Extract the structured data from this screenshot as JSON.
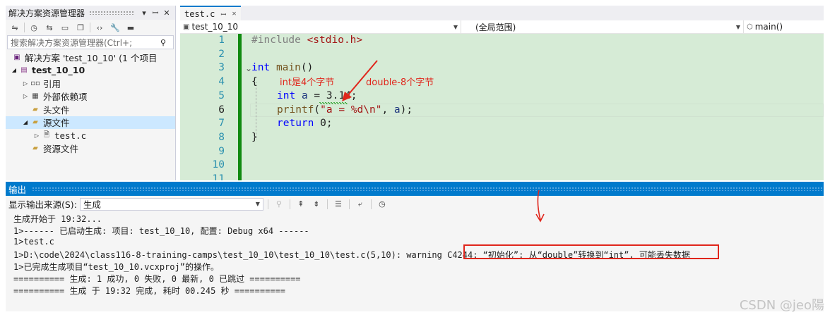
{
  "solution_explorer": {
    "title": "解决方案资源管理器",
    "search_placeholder": "搜索解决方案资源管理器(Ctrl+;",
    "items": [
      {
        "label": "解决方案 'test_10_10' (1 个项目"
      },
      {
        "label": "test_10_10"
      },
      {
        "label": "引用"
      },
      {
        "label": "外部依赖项"
      },
      {
        "label": "头文件"
      },
      {
        "label": "源文件"
      },
      {
        "label": "test.c"
      },
      {
        "label": "资源文件"
      }
    ]
  },
  "editor": {
    "tab_label": "test.c",
    "nav_project": "test_10_10",
    "nav_scope": "(全局范围)",
    "nav_member": "main()",
    "line_numbers": [
      "1",
      "2",
      "3",
      "4",
      "5",
      "6",
      "7",
      "8",
      "9",
      "10",
      "11"
    ],
    "current_line": "6",
    "code": {
      "l1_directive": "#include",
      "l1_header": "<stdio.h>",
      "l3_type": "int",
      "l3_name": "main",
      "l3_parens": "()",
      "l4_brace": "{",
      "l5_type": "int",
      "l5_var": "a",
      "l5_eq": " = ",
      "l5_value": "3.14",
      "l5_semi": ";",
      "l6_fn": "printf",
      "l6_open": "(",
      "l6_str1": "\"a = ",
      "l6_fmt": "%d\\n",
      "l6_str2": "\"",
      "l6_rest": ", ",
      "l6_var": "a",
      "l6_close": ");",
      "l7_kw": "return",
      "l7_value": "0",
      "l7_semi": ";",
      "l8_brace": "}"
    },
    "annotations": {
      "int_note": "int是4个字节",
      "double_note": "double-8个字节"
    }
  },
  "output": {
    "title": "输出",
    "source_label": "显示输出来源(S):",
    "source_value": "生成",
    "lines": [
      "生成开始于 19:32...",
      "1>------ 已启动生成: 项目: test_10_10, 配置: Debug x64 ------",
      "1>test.c",
      "1>D:\\code\\2024\\class116-8-training-camps\\test_10_10\\test_10_10\\test.c(5,10): warning C4244: “初始化”: 从“double”转换到“int”, 可能丢失数据",
      "1>已完成生成项目“test_10_10.vcxproj”的操作。",
      "========== 生成: 1 成功, 0 失败, 0 最新, 0 已跳过 ==========",
      "========== 生成 于 19:32 完成, 耗时 00.245 秒 =========="
    ]
  },
  "watermark": "CSDN @jeo陽",
  "colors": {
    "accent": "#007acc",
    "code_background": "#d6ebd6",
    "annotation": "#e0261c"
  }
}
